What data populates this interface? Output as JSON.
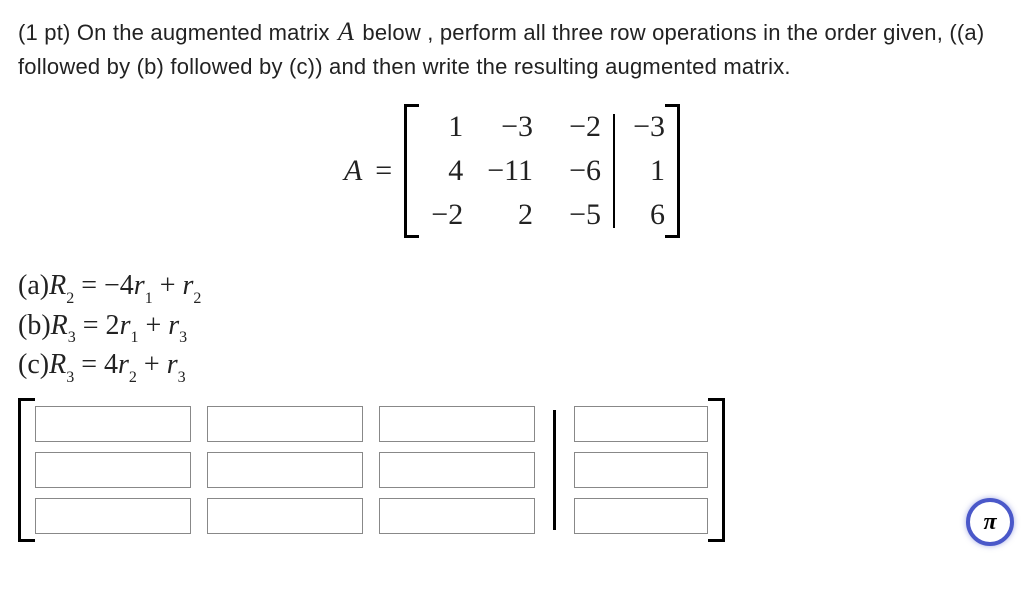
{
  "problem": {
    "part1": "(1 pt) On the augmented matrix ",
    "part2": " below , perform all three row operations in the order given, ((a) followed by (b) followed by (c)) and then write the resulting augmented matrix."
  },
  "matrix_label": "A",
  "equals": "=",
  "matrix": {
    "coeffs": [
      [
        "1",
        "−3",
        "−2"
      ],
      [
        "4",
        "−11",
        "−6"
      ],
      [
        "−2",
        "2",
        "−5"
      ]
    ],
    "aug": [
      "−3",
      "1",
      "6"
    ]
  },
  "operations": {
    "a": {
      "label": "(a)",
      "lhs_R": "R",
      "lhs_sub": "2",
      "rhs": "= −4",
      "r1": "r",
      "s1": "1",
      "plus": " + ",
      "r2": "r",
      "s2": "2"
    },
    "b": {
      "label": "(b)",
      "lhs_R": "R",
      "lhs_sub": "3",
      "rhs": "= 2",
      "r1": "r",
      "s1": "1",
      "plus": " + ",
      "r2": "r",
      "s2": "3"
    },
    "c": {
      "label": "(c)",
      "lhs_R": "R",
      "lhs_sub": "3",
      "rhs": "= 4",
      "r1": "r",
      "s1": "2",
      "plus": " + ",
      "r2": "r",
      "s2": "3"
    }
  },
  "pi_label": "π",
  "answer_inputs": {
    "rows": 3,
    "cols_coeff": 3,
    "cols_aug": 1
  }
}
